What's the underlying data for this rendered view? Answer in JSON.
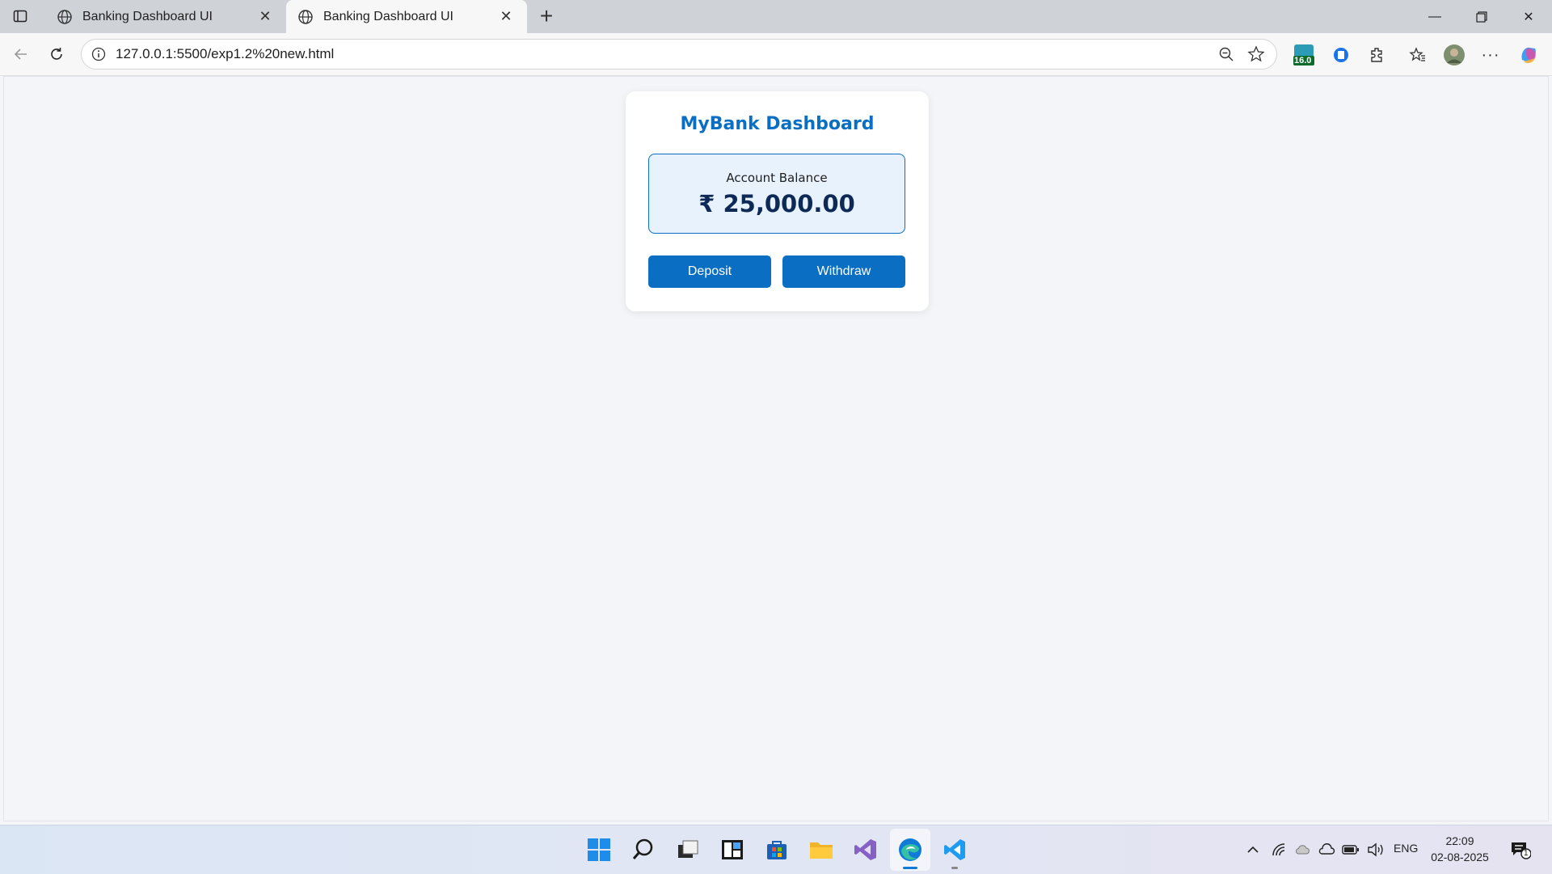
{
  "browser": {
    "tabs": [
      {
        "title": "Banking Dashboard UI",
        "active": false
      },
      {
        "title": "Banking Dashboard UI",
        "active": true
      }
    ],
    "url": "127.0.0.1:5500/exp1.2%20new.html",
    "extension_badge": "16.0"
  },
  "page": {
    "title": "MyBank Dashboard",
    "balance_label": "Account Balance",
    "balance_amount": "₹ 25,000.00",
    "deposit_label": "Deposit",
    "withdraw_label": "Withdraw"
  },
  "taskbar": {
    "language": "ENG",
    "time": "22:09",
    "date": "02-08-2025",
    "notification_count": "1"
  },
  "colors": {
    "accent": "#0a6fc2",
    "balance_bg": "#e8f2fd",
    "amount_text": "#0d2a57"
  }
}
